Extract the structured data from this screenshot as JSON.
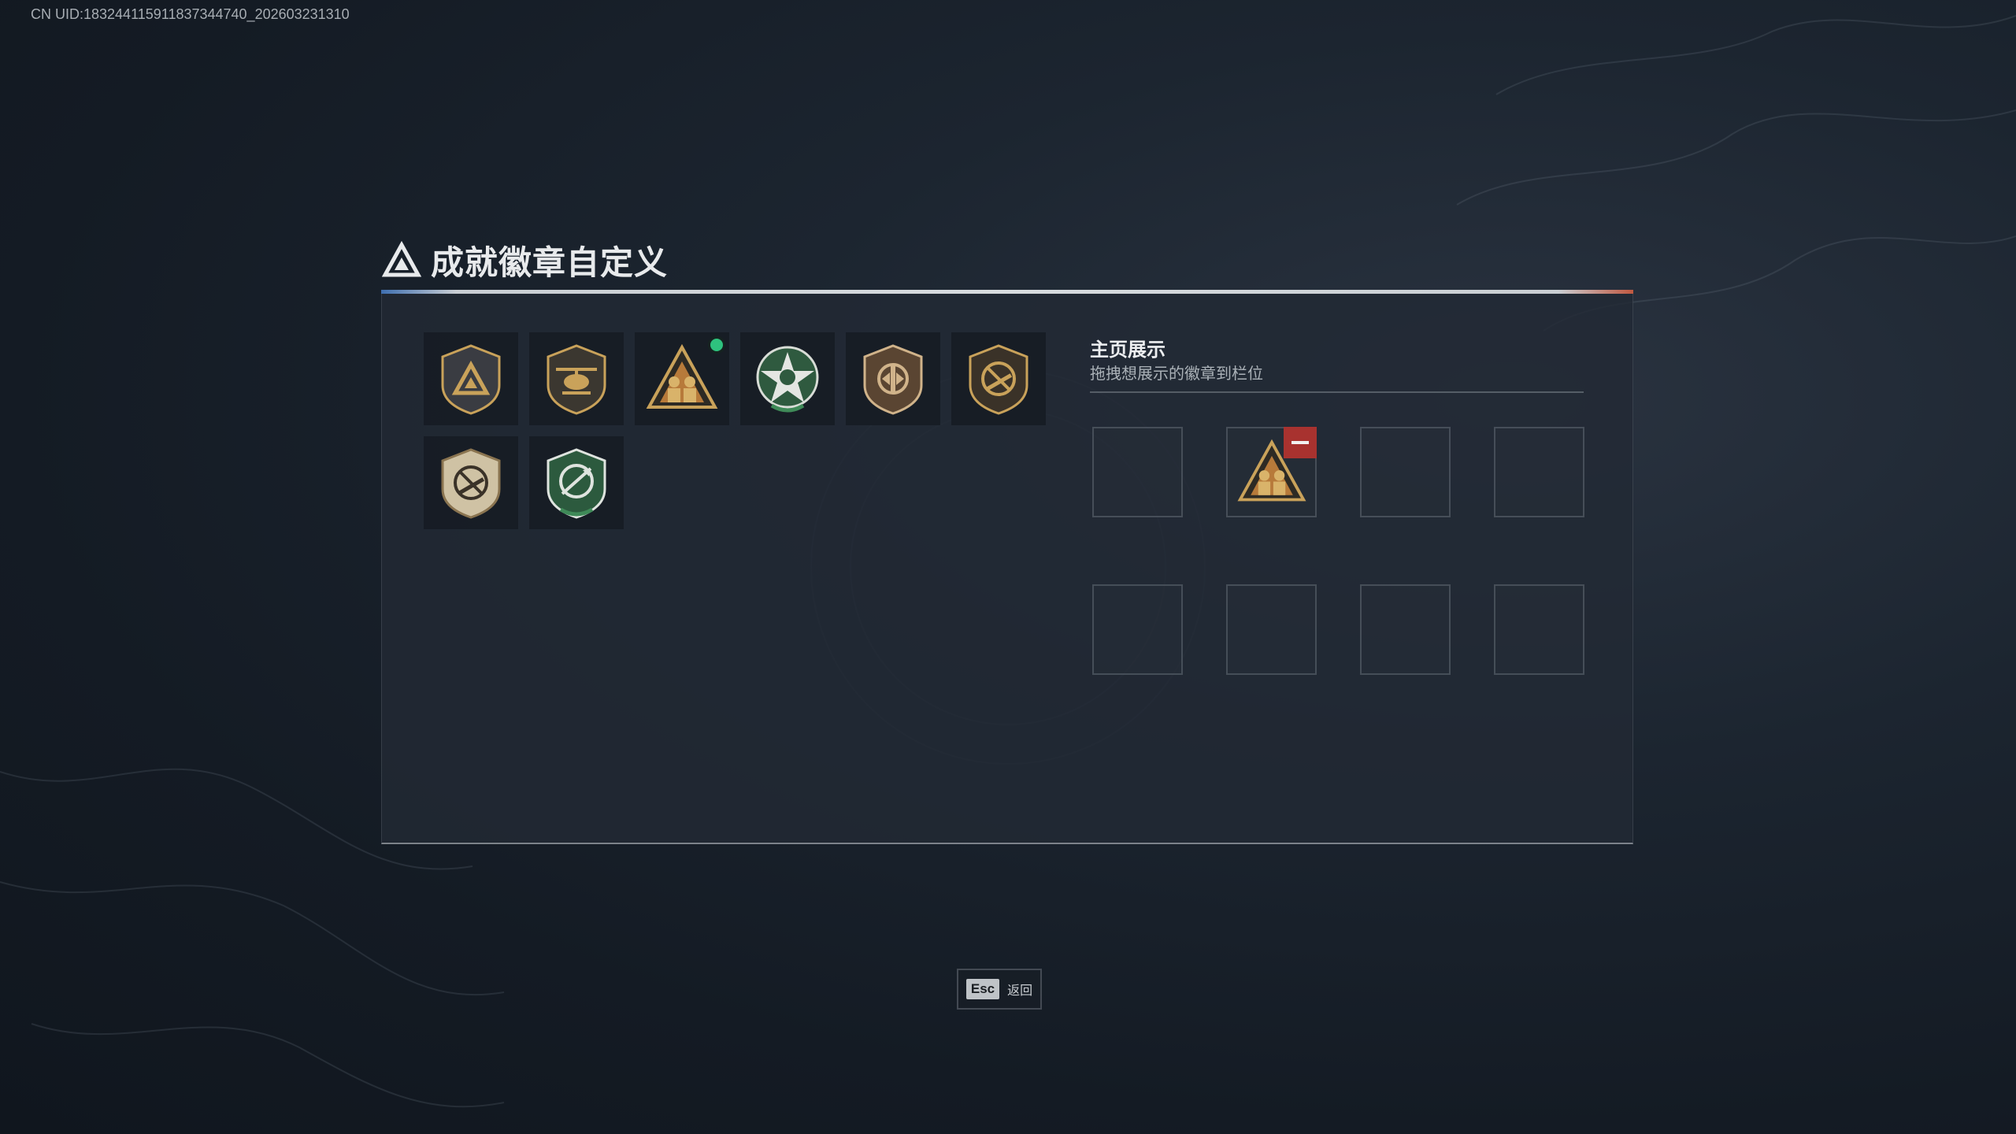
{
  "uid_text": "CN UID:18324411591183734474​0_202603231310",
  "header": {
    "title": "成就徽章自定义",
    "micro_text": ""
  },
  "badges": [
    {
      "icon": "delta-triangle-shield-icon",
      "new": false
    },
    {
      "icon": "helicopter-shield-icon",
      "new": false
    },
    {
      "icon": "soldiers-triangle-badge-icon",
      "new": true
    },
    {
      "icon": "green-star-medal-icon",
      "new": false
    },
    {
      "icon": "bronze-crest-shield-icon",
      "new": false
    },
    {
      "icon": "no-rifle-shield-icon",
      "new": false
    },
    {
      "icon": "no-rifle-gold-shield-icon",
      "new": false
    },
    {
      "icon": "green-crossed-arrows-shield-icon",
      "new": false
    }
  ],
  "showcase": {
    "title": "主页展示",
    "subtitle": "拖拽想展示的徽章到栏位",
    "slots": [
      {
        "filled": false
      },
      {
        "filled": true,
        "icon": "soldiers-triangle-badge-icon"
      },
      {
        "filled": false
      },
      {
        "filled": false
      },
      {
        "filled": false
      },
      {
        "filled": false
      },
      {
        "filled": false
      },
      {
        "filled": false
      }
    ]
  },
  "footer": {
    "esc_key": "Esc",
    "back_label": "返回"
  },
  "colors": {
    "accent_green": "#2ec27e",
    "remove_red": "#a8322f",
    "gold": "#c9a25a"
  }
}
